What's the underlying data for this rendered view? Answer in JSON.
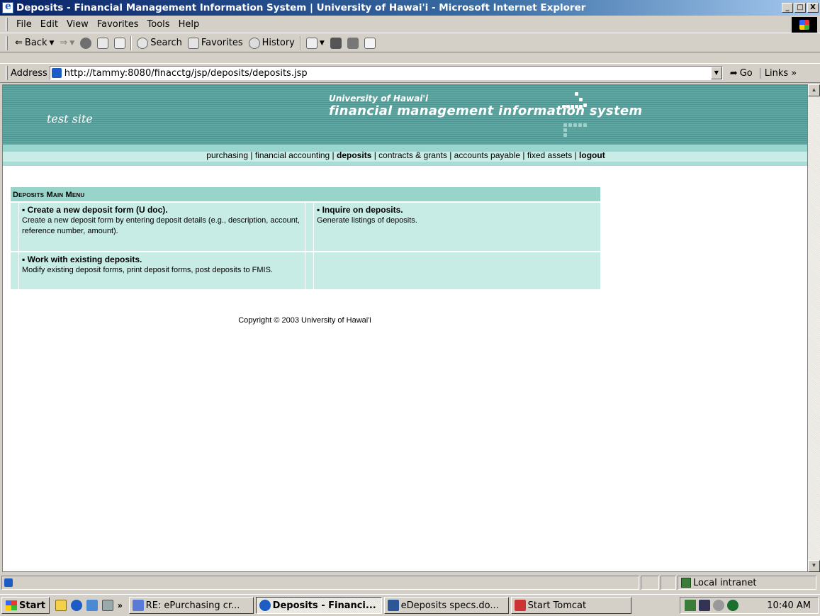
{
  "window": {
    "title": "Deposits - Financial Management Information System | University of Hawai'i - Microsoft Internet Explorer",
    "minimize": "_",
    "maximize": "□",
    "close": "X"
  },
  "menubar": {
    "items": [
      "File",
      "Edit",
      "View",
      "Favorites",
      "Tools",
      "Help"
    ]
  },
  "toolbar": {
    "back": "Back",
    "search": "Search",
    "favorites": "Favorites",
    "history": "History"
  },
  "address": {
    "label": "Address",
    "url": "http://tammy:8080/finacctg/jsp/deposits/deposits.jsp",
    "go": "Go",
    "links": "Links"
  },
  "page": {
    "header": {
      "site_label": "test site",
      "logo_line1": "University of Hawai'i",
      "logo_line2": "financial management information system"
    },
    "nav": {
      "links": [
        {
          "label": "purchasing",
          "bold": false
        },
        {
          "label": "financial accounting",
          "bold": false
        },
        {
          "label": "deposits",
          "bold": true
        },
        {
          "label": "contracts & grants",
          "bold": false
        },
        {
          "label": "accounts payable",
          "bold": false
        },
        {
          "label": "fixed assets",
          "bold": false
        },
        {
          "label": "logout",
          "bold": true
        }
      ],
      "separator": " | "
    },
    "menu": {
      "heading": "Deposits Main Menu",
      "items": [
        {
          "title": "Create a new deposit form (U doc).",
          "description": "Create a new deposit form by entering deposit details (e.g., description, account, reference number, amount)."
        },
        {
          "title": "Inquire on deposits.",
          "description": "Generate listings of deposits."
        },
        {
          "title": "Work with existing deposits.",
          "description": "Modify existing deposit forms, print deposit forms, post deposits to FMIS."
        }
      ]
    },
    "copyright": "Copyright © 2003 University of Hawai'i"
  },
  "statusbar": {
    "zone": "Local intranet"
  },
  "taskbar": {
    "start": "Start",
    "tasks": [
      {
        "label": "RE: ePurchasing cr...",
        "active": false
      },
      {
        "label": "Deposits - Financi...",
        "active": true
      },
      {
        "label": "eDeposits specs.do...",
        "active": false
      },
      {
        "label": "Start Tomcat",
        "active": false
      }
    ],
    "clock": "10:40 AM"
  },
  "colors": {
    "header_teal": "#5ea7a2",
    "menu_heading": "#99d4cb",
    "menu_cell": "#c7ebe5",
    "title_bar": "#0a246a"
  }
}
